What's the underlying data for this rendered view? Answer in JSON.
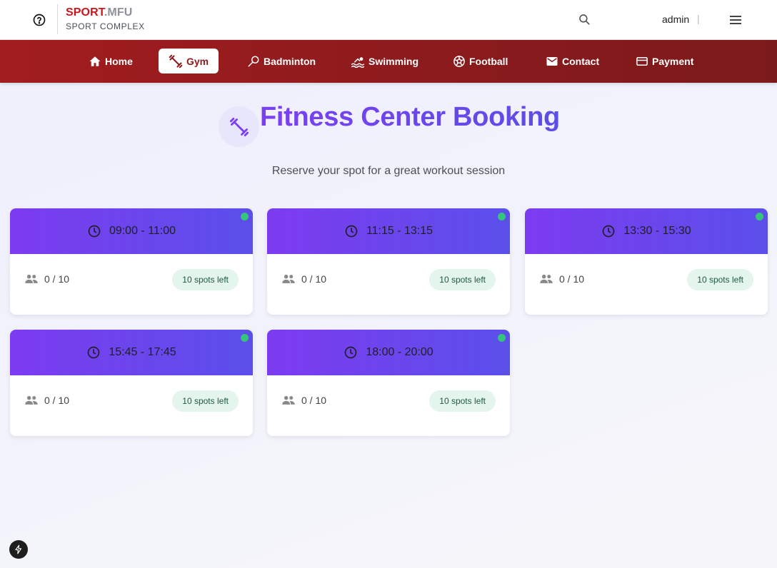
{
  "header": {
    "brand_primary": "SPORT",
    "brand_secondary": ".MFU",
    "brand_subtitle": "SPORT COMPLEX",
    "user_name": "admin",
    "separator": "|",
    "icons": [
      "help-circle-icon",
      "search-icon",
      "menu-icon"
    ]
  },
  "nav": {
    "items": [
      {
        "label": "Home",
        "icon": "home-icon"
      },
      {
        "label": "Gym",
        "icon": "dumbbell-icon",
        "active": true
      },
      {
        "label": "Badminton",
        "icon": "racket-icon"
      },
      {
        "label": "Swimming",
        "icon": "swimming-icon"
      },
      {
        "label": "Football",
        "icon": "football-icon"
      },
      {
        "label": "Contact",
        "icon": "mail-icon"
      },
      {
        "label": "Payment",
        "icon": "credit-card-icon"
      }
    ]
  },
  "page": {
    "title": "Fitness Center Booking",
    "subtitle": "Reserve your spot for a great workout session"
  },
  "slots": [
    {
      "time": "09:00 - 11:00",
      "capacity": "0 / 10",
      "spots": "10 spots left"
    },
    {
      "time": "11:15 - 13:15",
      "capacity": "0 / 10",
      "spots": "10 spots left"
    },
    {
      "time": "13:30 - 15:30",
      "capacity": "0 / 10",
      "spots": "10 spots left"
    },
    {
      "time": "15:45 - 17:45",
      "capacity": "0 / 10",
      "spots": "10 spots left"
    },
    {
      "time": "18:00 - 20:00",
      "capacity": "0 / 10",
      "spots": "10 spots left"
    }
  ],
  "colors": {
    "brand_red": "#c8161d",
    "nav_gradient_start": "#a21d1f",
    "nav_gradient_end": "#7b1a1c",
    "accent_purple": "#7b3ff2",
    "accent_indigo": "#5a4fe9",
    "status_green": "#35c47c",
    "badge_bg": "#e3f5ec"
  }
}
